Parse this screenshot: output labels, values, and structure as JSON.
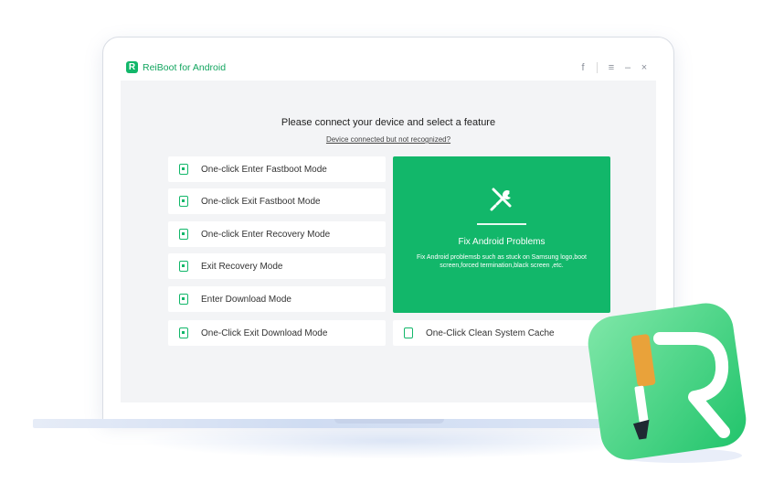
{
  "app": {
    "title": "ReiBoot for Android",
    "logo_letter": "R"
  },
  "titlebar": {
    "facebook_icon": "f",
    "menu_icon": "≡",
    "minimize_icon": "–",
    "close_icon": "×"
  },
  "main": {
    "headline": "Please connect your device and select a feature",
    "help_link": "Device connected but not recognized?",
    "options": [
      {
        "label": "One-click Enter Fastboot Mode",
        "icon": "fastboot-enter-icon"
      },
      {
        "label": "One-click Exit Fastboot Mode",
        "icon": "fastboot-exit-icon"
      },
      {
        "label": "One-click Enter Recovery Mode",
        "icon": "recovery-enter-icon"
      },
      {
        "label": "Exit Recovery Mode",
        "icon": "recovery-exit-icon"
      },
      {
        "label": "Enter Download Mode",
        "icon": "download-enter-icon"
      },
      {
        "label": "One-Click Exit Download Mode",
        "icon": "download-exit-icon"
      }
    ],
    "feature": {
      "title": "Fix Android Problems",
      "description": "Fix Android problemsb such as stuck on Samsung logo,boot screen,forced termination,black screen ,etc.",
      "icon": "tools-icon"
    },
    "clean_cache": {
      "label": "One-Click Clean System Cache",
      "icon": "cache-icon"
    }
  },
  "colors": {
    "accent": "#12b76a",
    "background": "#f3f4f6"
  }
}
